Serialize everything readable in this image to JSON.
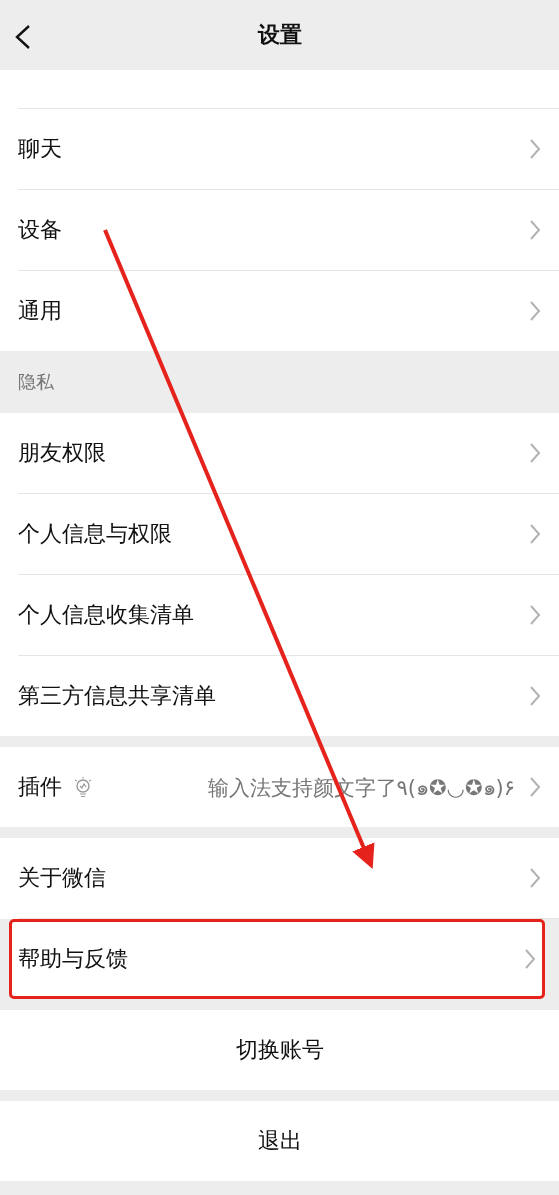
{
  "header": {
    "title": "设置"
  },
  "groups": [
    {
      "cut_top": true,
      "items": [
        {
          "label": "聊天",
          "highlighted": false
        },
        {
          "label": "设备",
          "highlighted": false
        },
        {
          "label": "通用",
          "highlighted": false
        }
      ]
    },
    {
      "label": "隐私",
      "items": [
        {
          "label": "朋友权限",
          "highlighted": false
        },
        {
          "label": "个人信息与权限",
          "highlighted": false
        },
        {
          "label": "个人信息收集清单",
          "highlighted": false
        },
        {
          "label": "第三方信息共享清单",
          "highlighted": false
        }
      ]
    },
    {
      "items": [
        {
          "label": "插件",
          "has_bulb": true,
          "detail": "输入法支持颜文字了٩(๑✪◡✪๑)۶",
          "highlighted": false
        }
      ]
    },
    {
      "items": [
        {
          "label": "关于微信",
          "highlighted": false
        },
        {
          "label": "帮助与反馈",
          "highlighted": true
        }
      ]
    }
  ],
  "actions": [
    "切换账号",
    "退出"
  ]
}
